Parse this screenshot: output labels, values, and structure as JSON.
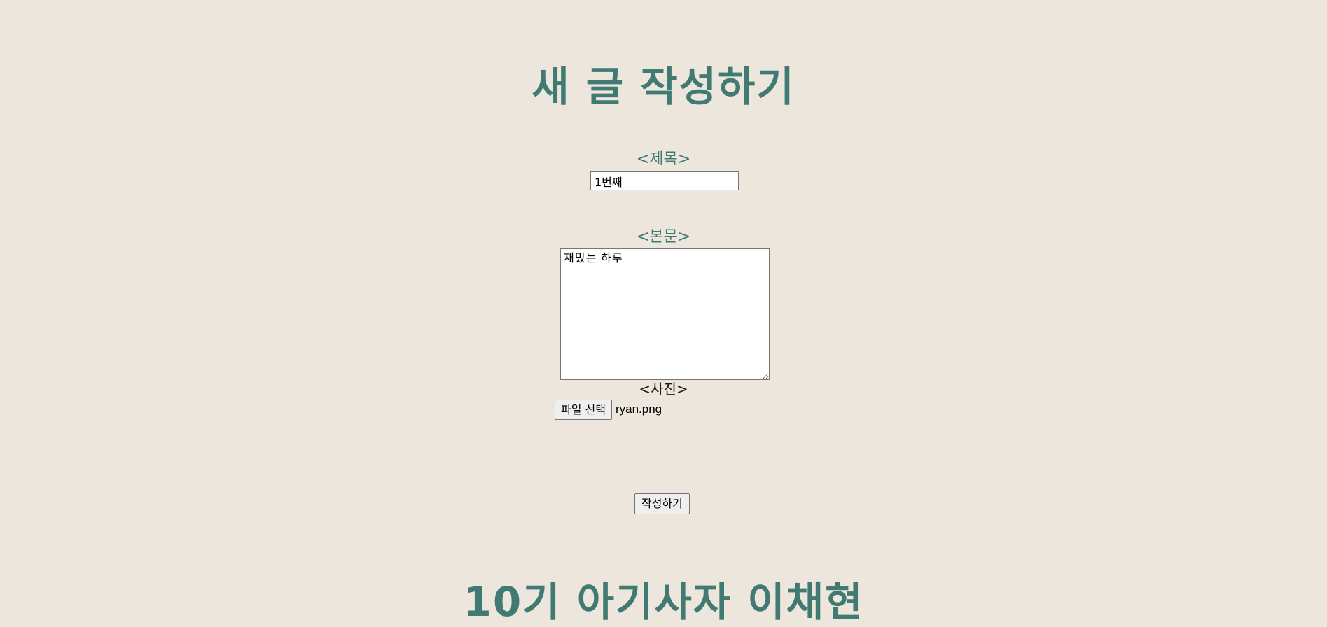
{
  "page": {
    "heading": "새 글 작성하기",
    "footer_heading": "10기 아기사자 이채현"
  },
  "form": {
    "title_label": "<제목>",
    "title_value": "1번째",
    "body_label": "<본문>",
    "body_value": "재밌는 하루",
    "photo_label": "<사진>",
    "file_button_label": "파일 선택",
    "file_name": "ryan.png",
    "submit_label": "작성하기"
  },
  "colors": {
    "background": "#ede6dc",
    "accent": "#417a73"
  }
}
